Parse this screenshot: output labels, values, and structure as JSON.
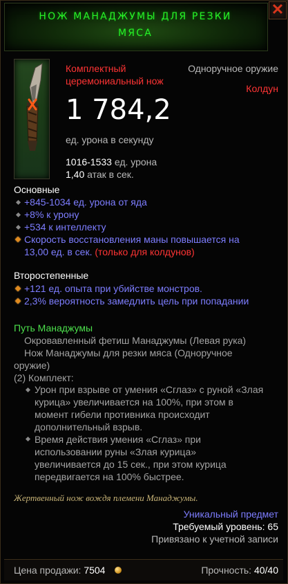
{
  "header": {
    "title_line1": "НОЖ МАНАДЖУМЫ ДЛЯ РЕЗКИ",
    "title_line2": "МЯСА",
    "close_icon": "close-x-icon"
  },
  "item": {
    "icon": "ceremonial-knife-icon",
    "type_line1": "Комплектный",
    "type_line2": "церемониальный нож",
    "slot": "Одноручное оружие",
    "class": "Колдун",
    "dps": "1 784,2",
    "dps_label": "ед. урона в секунду",
    "damage_range": "1016-1533",
    "damage_label": "ед. урона",
    "attack_speed": "1,40",
    "attack_speed_label": "атак в сек."
  },
  "primary": {
    "heading": "Основные",
    "stats": [
      "+845-1034 ед. урона от яда",
      "+8% к урону",
      "+534 к интеллекту"
    ],
    "special_line1": "Скорость восстановления маны повышается на",
    "special_line2_value": "13,00 ед. в сек.",
    "special_line2_note": "(только для колдунов)"
  },
  "secondary": {
    "heading": "Второстепенные",
    "stats": [
      "+121 ед. опыта при убийстве монстров.",
      "2,3% вероятность замедлить цель при попадании"
    ]
  },
  "set": {
    "name": "Путь Манаджумы",
    "items": [
      "Окровавленный фетиш Манаджумы (Левая рука)",
      "Нож Манаджумы для резки мяса (Одноручное",
      "оружие)"
    ],
    "bonus_heading": "(2) Комплект:",
    "bonus1": [
      "Урон при взрыве от умения «Сглаз» с руной «Злая",
      "курица» увеличивается на 100%, при этом в",
      "момент гибели противника происходит",
      "дополнительный взрыв."
    ],
    "bonus2": [
      "Время действия умения «Сглаз» при",
      "использовании руны «Злая курица»",
      "увеличивается до 15 сек., при этом курица",
      "передвигается на 100% быстрее."
    ]
  },
  "flavor": "Жертвенный нож вождя племени Манаджумы.",
  "meta": {
    "unique": "Уникальный предмет",
    "required_level": "Требуемый уровень: 65",
    "bound": "Привязано к учетной записи"
  },
  "footer": {
    "sell_label": "Цена продажи:",
    "sell_value": "7504",
    "coin_icon": "gold-coin-icon",
    "durability_label": "Прочность:",
    "durability_value": "40/40"
  },
  "colors": {
    "title_green": "#27f227",
    "red": "#ff3434",
    "magic_blue": "#7d7dff",
    "set_green": "#4ce04c",
    "flavor_gold": "#c7b377"
  }
}
